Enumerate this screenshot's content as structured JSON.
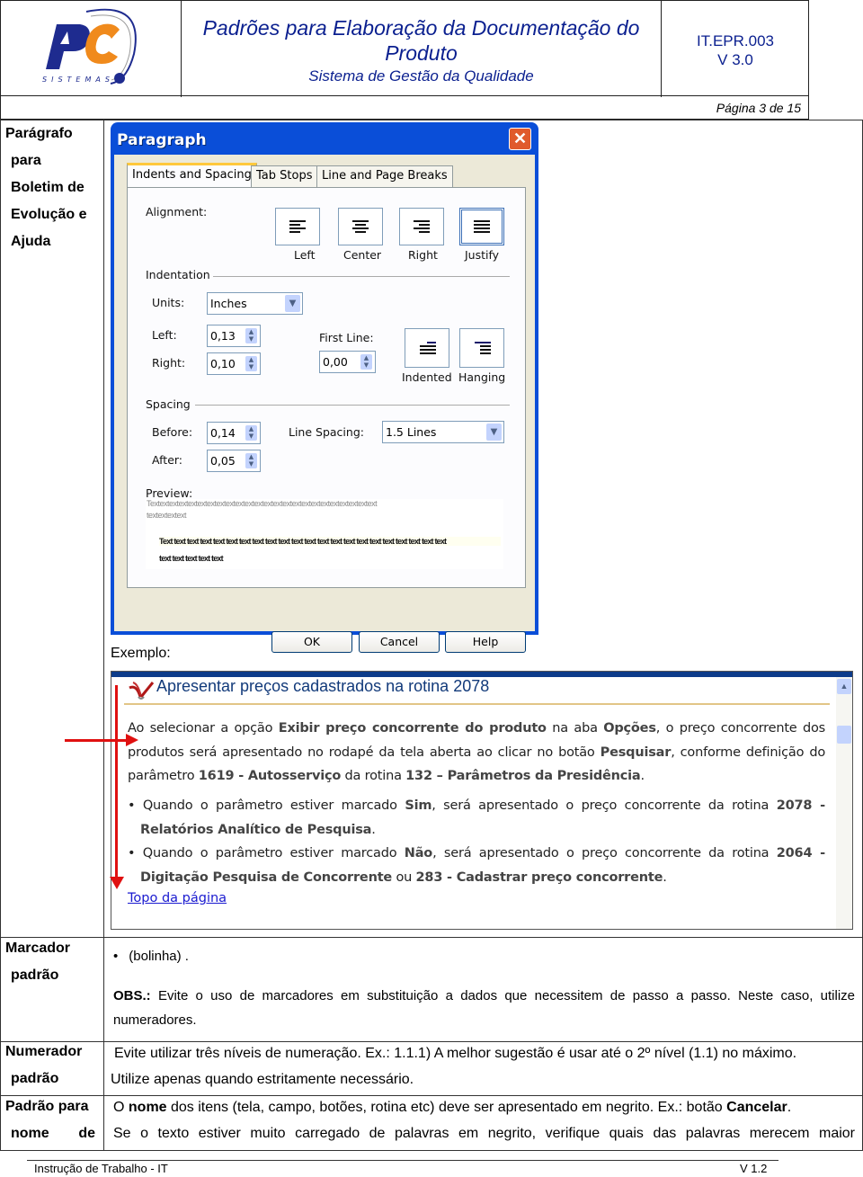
{
  "header": {
    "logo_text": "SISTEMAS",
    "title": "Padrões para Elaboração da Documentação do Produto",
    "subtitle": "Sistema de Gestão da Qualidade",
    "doc_code": "IT.EPR.003",
    "doc_version": "V 3.0",
    "page_info": "Página 3 de 15",
    "brand_colors": {
      "blue": "#1e2b8f",
      "orange": "#f08a1c"
    }
  },
  "rows": [
    {
      "label": [
        "Parágrafo",
        "para",
        "Boletim de",
        "Evolução e",
        "Ajuda"
      ],
      "example_label": "Exemplo:"
    },
    {
      "label": [
        "Marcador",
        "padrão"
      ],
      "bullet": "(bolinha) .",
      "obs_label": "OBS.:",
      "obs_text": "Evite o uso de marcadores em substituição a dados que necessitem de passo a passo. Neste caso, utilize numeradores."
    },
    {
      "label": [
        "Numerador",
        "padrão"
      ],
      "line1": "Evite utilizar três níveis de numeração. Ex.: 1.1.1) A melhor sugestão é usar até o 2º nível (1.1) no máximo.",
      "line2": "Utilize apenas quando estritamente necessário."
    },
    {
      "label": [
        "Padrão para",
        "nome de"
      ],
      "line1_a": "O ",
      "line1_bold": "nome",
      "line1_b": " dos itens (tela, campo, botões, rotina etc) deve ser apresentado em negrito. Ex.: botão ",
      "line1_bold2": "Cancelar",
      "line1_c": ".",
      "line2": "Se o texto estiver muito carregado de palavras em negrito, verifique quais das palavras merecem maior"
    }
  ],
  "dialog": {
    "title": "Paragraph",
    "tabs": [
      "Indents and Spacing",
      "Tab Stops",
      "Line and Page Breaks"
    ],
    "active_tab": "Indents and Spacing",
    "alignment_label": "Alignment:",
    "alignment_options": [
      "Left",
      "Center",
      "Right",
      "Justify"
    ],
    "alignment_selected": "Justify",
    "indentation_label": "Indentation",
    "units_label": "Units:",
    "units_value": "Inches",
    "left_label": "Left:",
    "left_value": "0,13",
    "right_label": "Right:",
    "right_value": "0,10",
    "first_line_label": "First Line:",
    "first_line_value": "0,00",
    "first_line_options": [
      "Indented",
      "Hanging"
    ],
    "spacing_label": "Spacing",
    "before_label": "Before:",
    "before_value": "0,14",
    "after_label": "After:",
    "after_value": "0,05",
    "line_spacing_label": "Line Spacing:",
    "line_spacing_value": "1.5 Lines",
    "preview_label": "Preview:",
    "preview_gray_1": "Textextextextextextextextextextextextextextextextextextextextextextextext",
    "preview_gray_2": "textextextext",
    "preview_black_1": "Text text text text text text text text text text text text text text text text text text text text text text",
    "preview_black_2": "text text text text text",
    "buttons": {
      "ok": "OK",
      "cancel": "Cancel",
      "help": "Help"
    }
  },
  "example": {
    "heading": "Apresentar preços cadastrados na rotina 2078",
    "para_1": [
      {
        "t": "Ao selecionar a opção "
      },
      {
        "b": "Exibir preço concorrente do produto"
      },
      {
        "t": " na aba "
      },
      {
        "b": "Opções"
      },
      {
        "t": ", o preço concorrente dos produtos será apresentado no rodapé da tela aberta ao clicar no botão "
      },
      {
        "b": "Pesquisar"
      },
      {
        "t": ", conforme definição do parâmetro "
      },
      {
        "b": "1619 - Autosserviço"
      },
      {
        "t": " da rotina "
      },
      {
        "b": "132 – Parâmetros da Presidência"
      },
      {
        "t": "."
      }
    ],
    "bullet_1": [
      {
        "t": " Quando o parâmetro estiver marcado "
      },
      {
        "b": "Sim"
      },
      {
        "t": ", será apresentado o preço concorrente da rotina "
      },
      {
        "b": "2078 - Relatórios Analítico de Pesquisa"
      },
      {
        "t": "."
      }
    ],
    "bullet_2": [
      {
        "t": "Quando o parâmetro estiver marcado "
      },
      {
        "b": "Não"
      },
      {
        "t": ", será apresentado o preço concorrente da rotina "
      },
      {
        "b": "2064 - Digitação Pesquisa de Concorrente"
      },
      {
        "t": " ou "
      },
      {
        "b": "283 - Cadastrar preço concorrente"
      },
      {
        "t": "."
      }
    ],
    "link": "Topo da página",
    "annotation_color": "#e01010"
  },
  "footer": {
    "left": "Instrução de Trabalho - IT",
    "right": "V 1.2"
  }
}
